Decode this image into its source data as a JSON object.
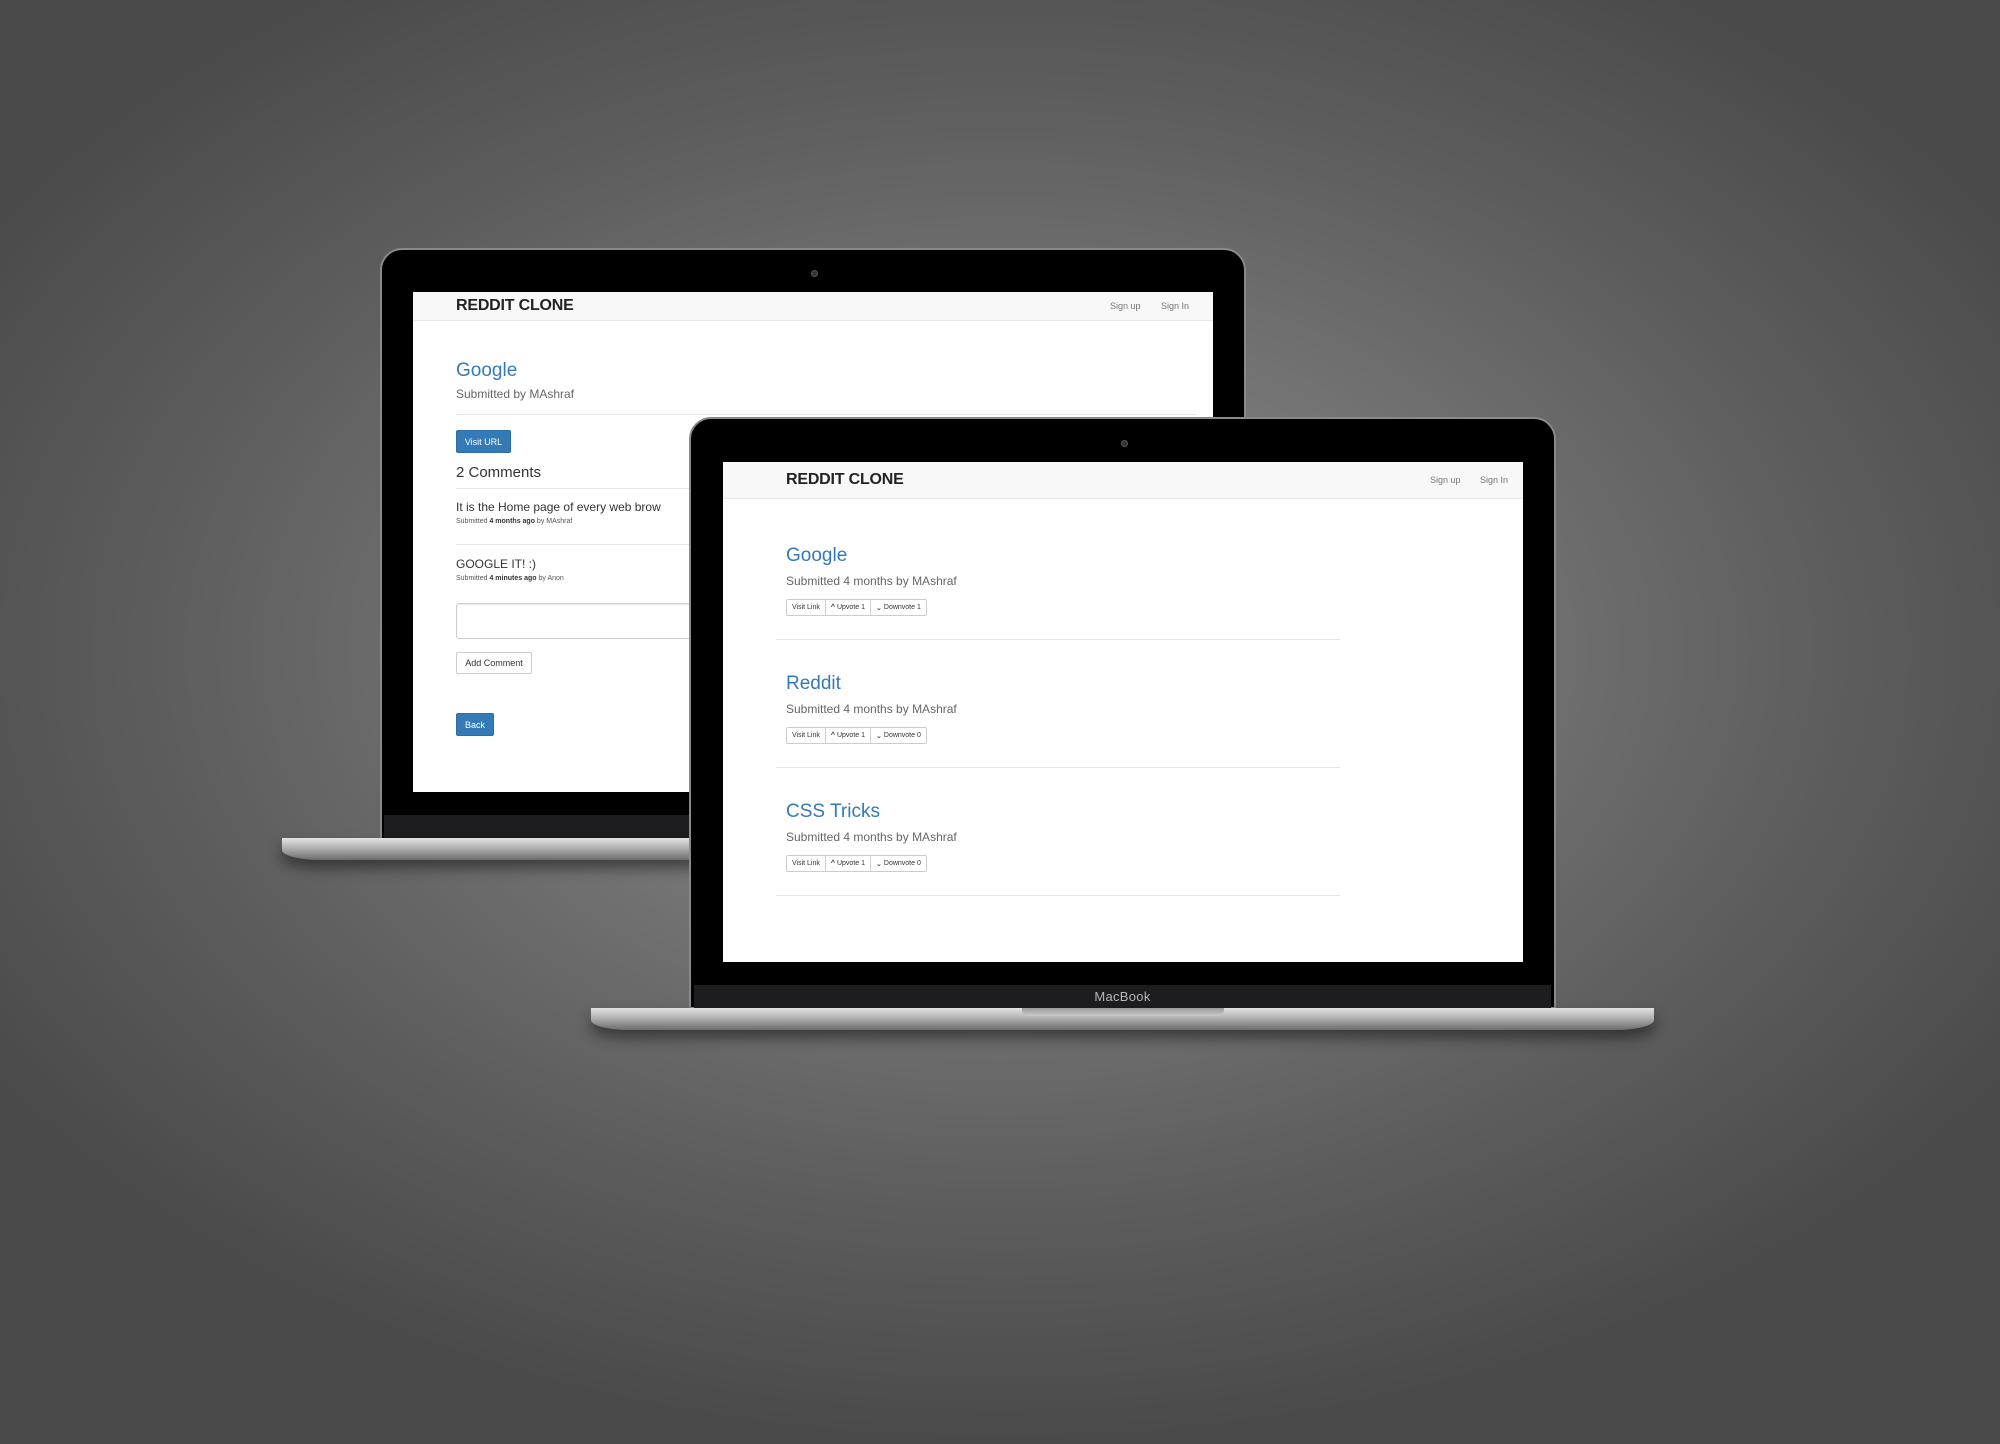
{
  "back_screen": {
    "brand": "REDDIT CLONE",
    "nav": {
      "sign_up": "Sign up",
      "sign_in": "Sign In"
    },
    "post": {
      "title": "Google",
      "submitted_by": "Submitted by MAshraf"
    },
    "visit_url_label": "Visit URL",
    "comments_heading": "2 Comments",
    "comments": [
      {
        "body": "It is the Home page of every web brow",
        "prefix": "Submitted ",
        "age": "4 months ago",
        "by": " by MAshraf"
      },
      {
        "body": "GOOGLE IT! :)",
        "prefix": "Submitted ",
        "age": "4 minutes ago",
        "by": " by Anon"
      }
    ],
    "comment_input_value": "",
    "add_comment_label": "Add Comment",
    "back_label": "Back"
  },
  "front_screen": {
    "brand": "REDDIT CLONE",
    "nav": {
      "sign_up": "Sign up",
      "sign_in": "Sign In"
    },
    "posts": [
      {
        "title": "Google",
        "meta": "Submitted 4 months by MAshraf",
        "visit": "Visit Link",
        "upvote": "Upvote 1",
        "downvote": "Downvote 1"
      },
      {
        "title": "Reddit",
        "meta": "Submitted 4 months by MAshraf",
        "visit": "Visit Link",
        "upvote": "Upvote 1",
        "downvote": "Downvote 0"
      },
      {
        "title": "CSS Tricks",
        "meta": "Submitted 4 months by MAshraf",
        "visit": "Visit Link",
        "upvote": "Upvote 1",
        "downvote": "Downvote 0"
      }
    ],
    "chin_label": "MacBook"
  },
  "icons": {
    "upvote": "chevron-up-icon",
    "downvote": "chevron-down-icon"
  },
  "colors": {
    "link": "#337ab7",
    "primary_button": "#337ab7",
    "background": "#6e6e6e"
  }
}
